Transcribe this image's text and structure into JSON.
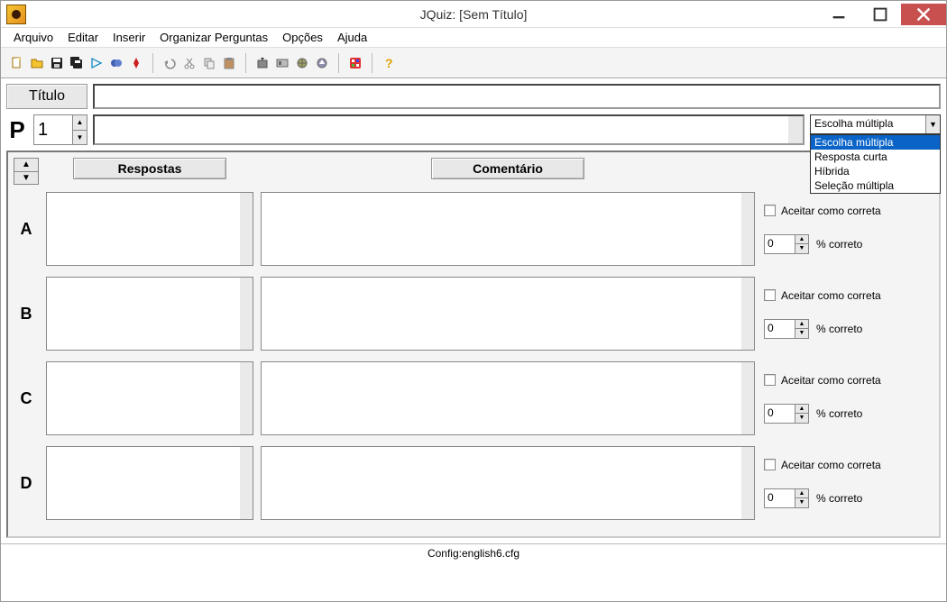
{
  "window": {
    "title": "JQuiz: [Sem Título]"
  },
  "menu": {
    "arquivo": "Arquivo",
    "editar": "Editar",
    "inserir": "Inserir",
    "organizar": "Organizar Perguntas",
    "opcoes": "Opções",
    "ajuda": "Ajuda"
  },
  "title_section": {
    "label": "Título",
    "value": ""
  },
  "question": {
    "label": "P",
    "number": "1",
    "text": ""
  },
  "question_type": {
    "selected": "Escolha múltipla",
    "options": [
      "Escolha múltipla",
      "Resposta curta",
      "Híbrida",
      "Seleção múltipla"
    ]
  },
  "columns": {
    "respostas": "Respostas",
    "comentario": "Comentário"
  },
  "answers": [
    {
      "letter": "A",
      "resposta": "",
      "comentario": "",
      "aceitar_label": "Aceitar como correta",
      "aceitar": false,
      "pct": "0",
      "pct_label": "% correto"
    },
    {
      "letter": "B",
      "resposta": "",
      "comentario": "",
      "aceitar_label": "Aceitar como correta",
      "aceitar": false,
      "pct": "0",
      "pct_label": "% correto"
    },
    {
      "letter": "C",
      "resposta": "",
      "comentario": "",
      "aceitar_label": "Aceitar como correta",
      "aceitar": false,
      "pct": "0",
      "pct_label": "% correto"
    },
    {
      "letter": "D",
      "resposta": "",
      "comentario": "",
      "aceitar_label": "Aceitar como correta",
      "aceitar": false,
      "pct": "0",
      "pct_label": "% correto"
    }
  ],
  "statusbar": {
    "config": "Config:english6.cfg"
  }
}
